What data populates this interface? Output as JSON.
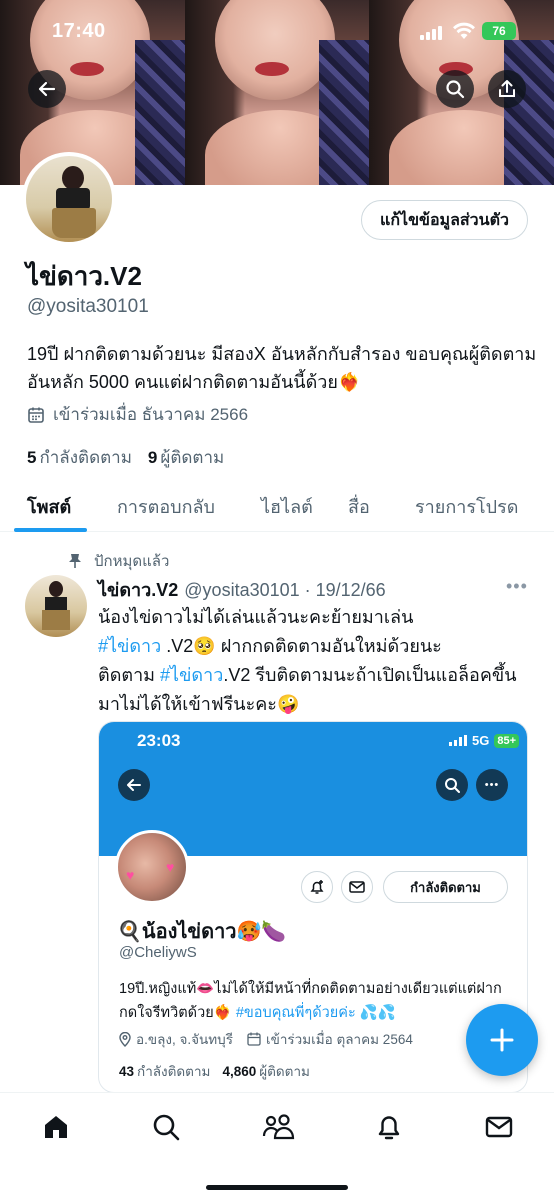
{
  "status_bar": {
    "time": "17:40",
    "battery": "76"
  },
  "profile": {
    "edit_button": "แก้ไขข้อมูลส่วนตัว",
    "display_name": "ไข่ดาว.V2",
    "handle": "@yosita30101",
    "bio": "19ปี ฝากติดตามด้วยนะ มีสองX อันหลักกับสำรอง ขอบคุณผู้ติดตามอันหลัก 5000 คนแต่ฝากติดตามอันนี้ด้วย❤️‍🔥",
    "joined": "เข้าร่วมเมื่อ ธันวาคม 2566",
    "following_count": "5",
    "following_label": "กำลังติดตาม",
    "followers_count": "9",
    "followers_label": "ผู้ติดตาม"
  },
  "tabs": [
    {
      "label": "โพสต์"
    },
    {
      "label": "การตอบกลับ"
    },
    {
      "label": "ไฮไลต์"
    },
    {
      "label": "สื่อ"
    },
    {
      "label": "รายการโปรด"
    }
  ],
  "tweet": {
    "pinned_label": "ปักหมุดแล้ว",
    "name": "ไข่ดาว.V2",
    "meta": "@yosita30101 · 19/12/66",
    "text_1": "น้องไข่ดาวไม่ได้เล่นแล้วนะคะย้ายมาเล่น",
    "hashtag_1": "#ไข่ดาว",
    "text_2": " .V2🥺 ฝากกดติดตามอันใหม่ด้วยนะ",
    "text_3": "ติดตาม ",
    "hashtag_2": "#ไข่ดาว",
    "text_4": ".V2 รีบติดตามนะถ้าเปิดเป็นแอล็อคขึ้นมาไม่ได้ให้เข้าฟรีนะคะ🤪"
  },
  "embed": {
    "time": "23:03",
    "network": "5G",
    "battery": "85+",
    "following_button": "กำลังติดตาม",
    "name": "🍳น้องไข่ดาว🥵🍆",
    "handle": "@CheliywS",
    "bio_1": "19ปี.หญิงแท้👄ไม่ได้ให้มีหน้าที่กดติดตามอย่างเดียวแต่แต่ฝากกดใจรีทวิตด้วย❤️‍🔥 ",
    "bio_hashtag": "#ขอบคุณพี่ๆด้วยค่ะ",
    "bio_2": " 💦💦",
    "location": "อ.ขลุง, จ.จันทบุรี",
    "joined": "เข้าร่วมเมื่อ ตุลาคม 2564",
    "following_count": "43",
    "following_label": "กำลังติดตาม",
    "followers_count": "4,860",
    "followers_label": "ผู้ติดตาม"
  },
  "icons": {
    "back": "back-arrow-icon",
    "search": "search-icon",
    "share": "share-icon",
    "calendar": "calendar-icon",
    "pin": "pin-icon",
    "more": "more-icon",
    "compose": "plus-icon",
    "nav": [
      "home-icon",
      "search-icon",
      "communities-icon",
      "bell-icon",
      "mail-icon"
    ]
  },
  "colors": {
    "accent": "#1d9bf0",
    "battery": "#34c759",
    "text_primary": "#0f1419",
    "text_secondary": "#536471"
  }
}
